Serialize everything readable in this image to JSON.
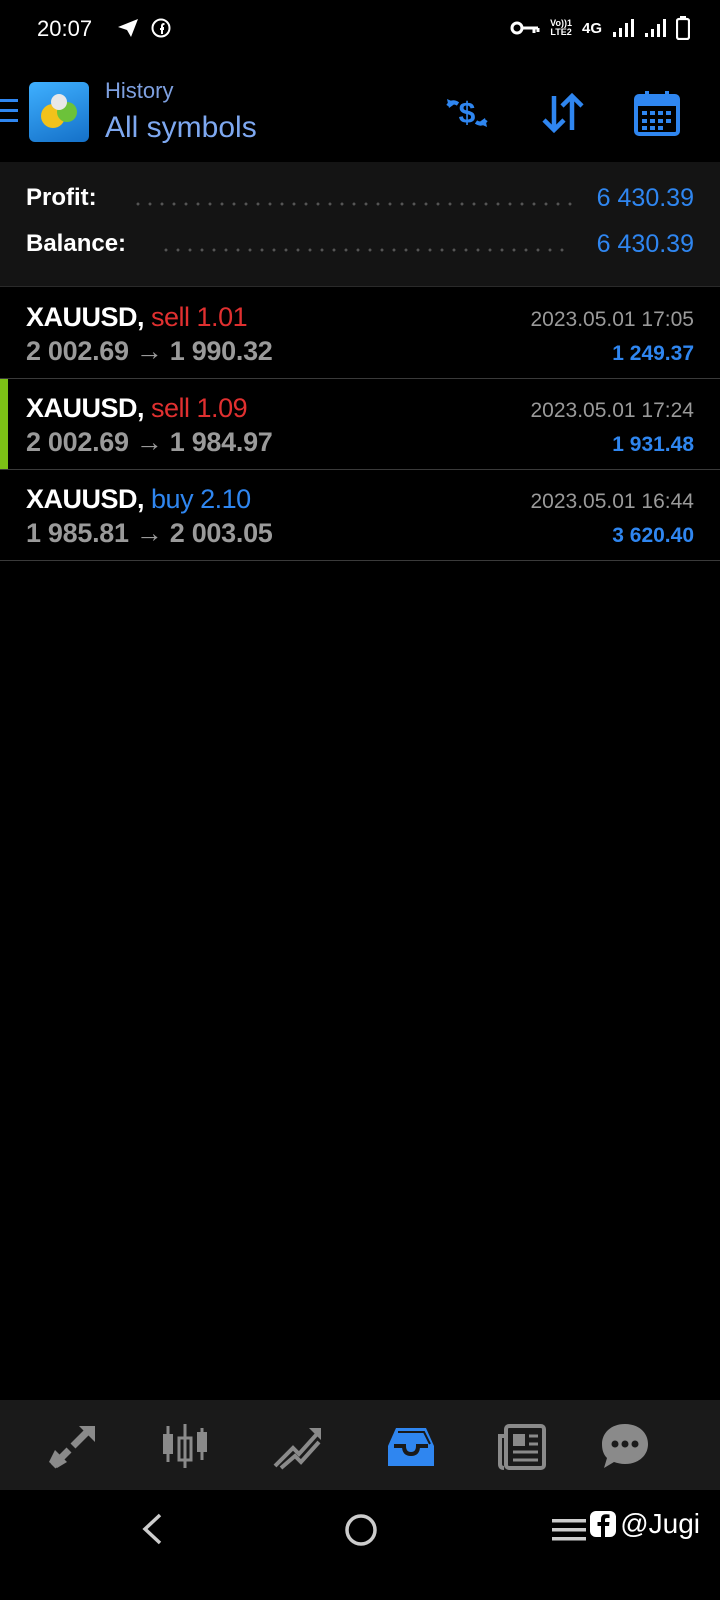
{
  "status_bar": {
    "time": "20:07",
    "network": "4G",
    "volte_line1": "Vo))1",
    "volte_line2": "LTE2"
  },
  "header": {
    "subtitle": "History",
    "title": "All symbols",
    "icons": [
      "menu-icon",
      "deposit-withdraw-icon",
      "sort-icon",
      "calendar-icon"
    ]
  },
  "summary": {
    "profit_label": "Profit:",
    "profit_value": "6 430.39",
    "balance_label": "Balance:",
    "balance_value": "6 430.39"
  },
  "trades": [
    {
      "symbol": "XAUUSD,",
      "side": "sell 1.01",
      "prices": "2 002.69 → 1 990.32",
      "time": "2023.05.01 17:05",
      "profit": "1 249.37"
    },
    {
      "symbol": "XAUUSD,",
      "side": "sell 1.09",
      "prices": "2 002.69 → 1 984.97",
      "time": "2023.05.01 17:24",
      "profit": "1 931.48"
    },
    {
      "symbol": "XAUUSD,",
      "side": "buy 2.10",
      "prices": "1 985.81 → 2 003.05",
      "time": "2023.05.01 16:44",
      "profit": "3 620.40"
    }
  ],
  "bottom_nav": [
    "quotes-icon",
    "chart-icon",
    "trade-icon",
    "history-icon",
    "news-icon",
    "chat-icon"
  ],
  "watermark": "@Jugi",
  "colors": {
    "accent": "#2f86f0",
    "sell": "#e03030",
    "marker": "#7cc016"
  }
}
